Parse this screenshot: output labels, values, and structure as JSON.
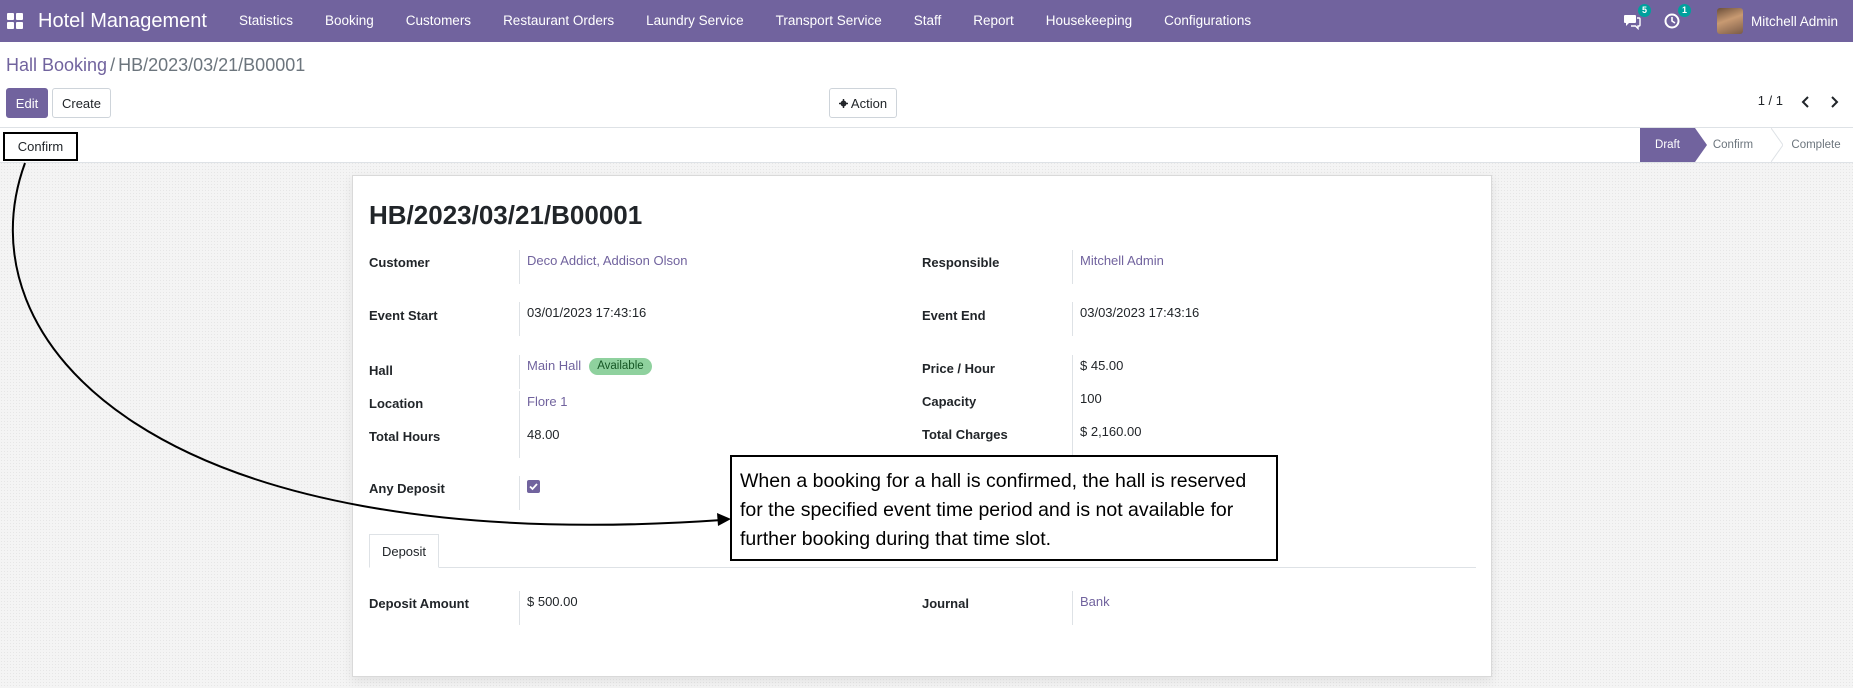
{
  "navbar": {
    "brand": "Hotel Management",
    "menu": [
      "Statistics",
      "Booking",
      "Customers",
      "Restaurant Orders",
      "Laundry Service",
      "Transport Service",
      "Staff",
      "Report",
      "Housekeeping",
      "Configurations"
    ],
    "messages_count": "5",
    "activities_count": "1",
    "user": "Mitchell Admin"
  },
  "breadcrumb": {
    "parent": "Hall Booking",
    "separator": "/",
    "current": "HB/2023/03/21/B00001"
  },
  "buttons": {
    "edit": "Edit",
    "create": "Create",
    "action": "Action",
    "confirm": "Confirm"
  },
  "pager": {
    "value": "1 / 1"
  },
  "stages": [
    {
      "label": "Draft",
      "active": true
    },
    {
      "label": "Confirm",
      "active": false
    },
    {
      "label": "Complete",
      "active": false
    }
  ],
  "record": {
    "title": "HB/2023/03/21/B00001",
    "customer_label": "Customer",
    "customer": "Deco Addict, Addison Olson",
    "responsible_label": "Responsible",
    "responsible": "Mitchell Admin",
    "event_start_label": "Event Start",
    "event_start": "03/01/2023 17:43:16",
    "event_end_label": "Event End",
    "event_end": "03/03/2023 17:43:16",
    "hall_label": "Hall",
    "hall": "Main Hall",
    "hall_status": "Available",
    "price_label": "Price / Hour",
    "price": "$ 45.00",
    "location_label": "Location",
    "location": "Flore 1",
    "capacity_label": "Capacity",
    "capacity": "100",
    "total_hours_label": "Total Hours",
    "total_hours": "48.00",
    "total_charges_label": "Total Charges",
    "total_charges": "$ 2,160.00",
    "any_deposit_label": "Any Deposit",
    "any_deposit": true
  },
  "tabs": {
    "deposit": "Deposit"
  },
  "deposit": {
    "amount_label": "Deposit Amount",
    "amount": "$ 500.00",
    "journal_label": "Journal",
    "journal": "Bank"
  },
  "annotation": {
    "text": "When a booking for a hall is confirmed, the hall is reserved for the specified event time period and is not available for further booking during that time slot."
  },
  "colors": {
    "primary": "#71639e",
    "badge": "#00a09d",
    "tag_available": "#8fd19e"
  }
}
